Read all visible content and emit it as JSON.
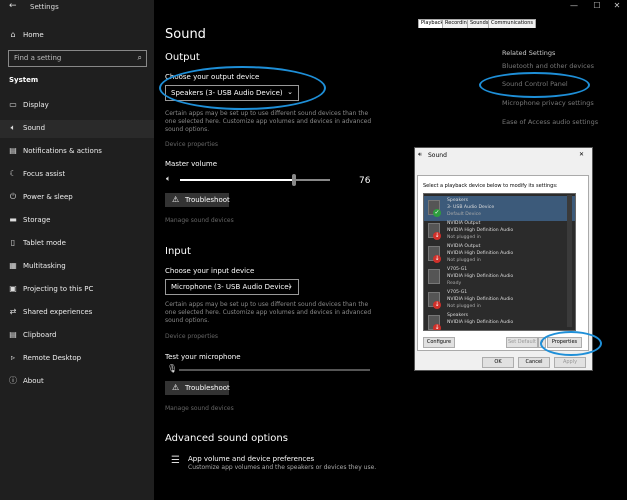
{
  "window": {
    "title": "Settings",
    "controls": {
      "minimize": "—",
      "maximize": "☐",
      "close": "✕"
    }
  },
  "sidebar": {
    "home": "Home",
    "search_placeholder": "Find a setting",
    "section": "System",
    "items": [
      {
        "label": "Display",
        "icon": "display-icon"
      },
      {
        "label": "Sound",
        "icon": "speaker-icon"
      },
      {
        "label": "Notifications & actions",
        "icon": "notifications-icon"
      },
      {
        "label": "Focus assist",
        "icon": "moon-icon"
      },
      {
        "label": "Power & sleep",
        "icon": "power-icon"
      },
      {
        "label": "Storage",
        "icon": "storage-icon"
      },
      {
        "label": "Tablet mode",
        "icon": "tablet-icon"
      },
      {
        "label": "Multitasking",
        "icon": "multitasking-icon"
      },
      {
        "label": "Projecting to this PC",
        "icon": "projecting-icon"
      },
      {
        "label": "Shared experiences",
        "icon": "shared-icon"
      },
      {
        "label": "Clipboard",
        "icon": "clipboard-icon"
      },
      {
        "label": "Remote Desktop",
        "icon": "remote-icon"
      },
      {
        "label": "About",
        "icon": "info-icon"
      }
    ]
  },
  "main": {
    "title": "Sound",
    "output": {
      "heading": "Output",
      "choose_label": "Choose your output device",
      "device": "Speakers (3- USB Audio Device)",
      "info": "Certain apps may be set up to use different sound devices than the one selected here. Customize app volumes and devices in advanced sound options.",
      "device_properties": "Device properties",
      "master_volume_label": "Master volume",
      "volume_value": "76",
      "volume_fraction": 0.76,
      "troubleshoot": "Troubleshoot",
      "manage_devices": "Manage sound devices"
    },
    "input": {
      "heading": "Input",
      "choose_label": "Choose your input device",
      "device": "Microphone (3- USB Audio Device)",
      "info": "Certain apps may be set up to use different sound devices than the one selected here. Customize app volumes and devices in advanced sound options.",
      "device_properties": "Device properties",
      "test_label": "Test your microphone",
      "troubleshoot": "Troubleshoot",
      "manage_devices": "Manage sound devices"
    },
    "advanced": {
      "heading": "Advanced sound options",
      "item_title": "App volume and device preferences",
      "item_desc": "Customize app volumes and the speakers or devices they use."
    }
  },
  "related": {
    "heading": "Related Settings",
    "links": [
      "Bluetooth and other devices",
      "Sound Control Panel",
      "Microphone privacy settings",
      "Ease of Access audio settings"
    ]
  },
  "dialog": {
    "title": "Sound",
    "close": "✕",
    "tabs": [
      "Playback",
      "Recording",
      "Sounds",
      "Communications"
    ],
    "instruction": "Select a playback device below to modify its settings:",
    "devices": [
      {
        "l1": "Speakers",
        "l2": "3- USB Audio Device",
        "l3": "Default Device",
        "status": "default"
      },
      {
        "l1": "NVIDIA Output",
        "l2": "NVIDIA High Definition Audio",
        "l3": "Not plugged in",
        "status": "unplugged"
      },
      {
        "l1": "NVIDIA Output",
        "l2": "NVIDIA High Definition Audio",
        "l3": "Not plugged in",
        "status": "unplugged"
      },
      {
        "l1": "V705-G1",
        "l2": "NVIDIA High Definition Audio",
        "l3": "Ready",
        "status": "ready"
      },
      {
        "l1": "V705-G1",
        "l2": "NVIDIA High Definition Audio",
        "l3": "Not plugged in",
        "status": "unplugged"
      },
      {
        "l1": "Speakers",
        "l2": "NVIDIA High Definition Audio",
        "l3": "",
        "status": "unplugged"
      }
    ],
    "configure": "Configure",
    "set_default": "Set Default",
    "properties": "Properties",
    "ok": "OK",
    "cancel": "Cancel",
    "apply": "Apply"
  },
  "colors": {
    "annotation": "#1e8fd8",
    "dialog_bg": "#f0f0f0",
    "sidebar_bg": "#1f1f1f"
  }
}
